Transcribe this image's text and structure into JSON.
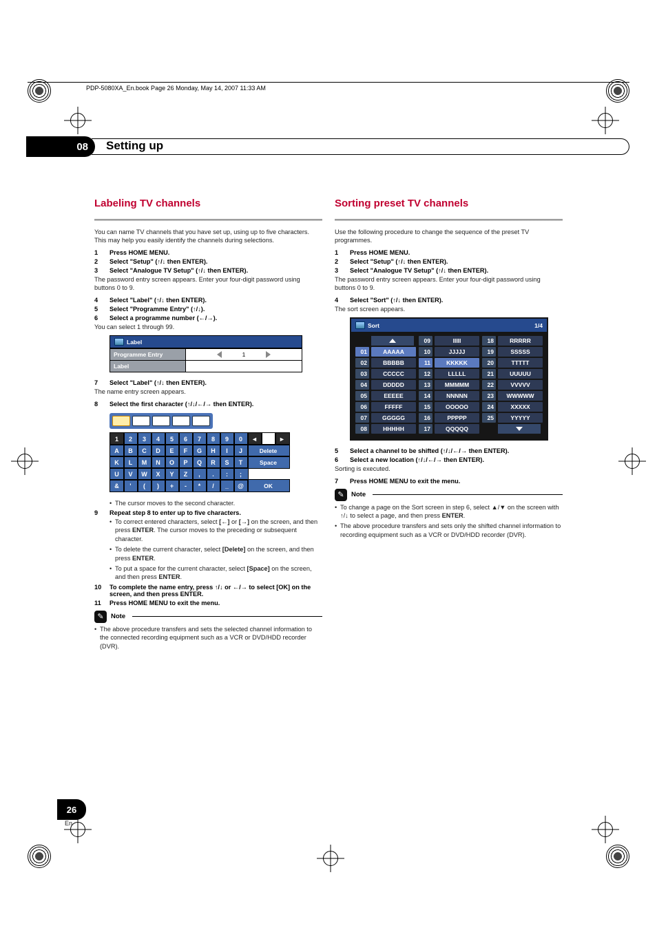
{
  "meta": {
    "header_text": "PDP-5080XA_En.book  Page 26  Monday, May 14, 2007  11:33 AM",
    "page_number": "26",
    "page_lang": "En"
  },
  "chapter": {
    "num": "08",
    "title": "Setting up"
  },
  "arrows": {
    "ud": "↑/↓",
    "lr": "←/→",
    "udlr": "↑/↓/←/→"
  },
  "left": {
    "heading": "Labeling TV channels",
    "intro": "You can name TV channels that you have set up, using up to five characters. This may help you easily identify the channels during selections.",
    "steps": {
      "s1": "Press HOME MENU.",
      "s2a": "Select \"Setup\" (",
      "s2b": " then ENTER).",
      "s3a": "Select \"Analogue TV Setup\" (",
      "s3b": " then ENTER).",
      "s3_sub": "The password entry screen appears. Enter your four-digit password using buttons 0 to 9.",
      "s4a": "Select \"Label\" (",
      "s4b": " then ENTER).",
      "s5a": "Select \"Programme Entry\" (",
      "s5b": ").",
      "s6a": "Select a programme number (",
      "s6b": ").",
      "s6_sub": "You can select 1 through 99.",
      "s7a": "Select \"Label\" (",
      "s7b": " then ENTER).",
      "s7_sub": "The name entry screen appears.",
      "s8a": "Select the first character (",
      "s8b": " then ENTER).",
      "s8_cursor": "The cursor moves to the second character.",
      "s9": "Repeat step 8 to enter up to five characters.",
      "s9_b1a": "To correct entered characters, select ",
      "s9_b1_left": "[←]",
      "s9_b1_or": " or ",
      "s9_b1_right": "[→]",
      "s9_b1b": " on the screen, and then press ",
      "s9_b1_enter": "ENTER",
      "s9_b1c": ". The cursor moves to the preceding or subsequent character.",
      "s9_b2a": "To delete the current character, select ",
      "s9_b2_del": "[Delete]",
      "s9_b2b": " on the screen, and then press ",
      "s9_b2_enter": "ENTER",
      "s9_b2c": ".",
      "s9_b3a": "To put a space for the current character, select ",
      "s9_b3_sp": "[Space]",
      "s9_b3b": " on the screen, and then press ",
      "s9_b3_enter": "ENTER",
      "s9_b3c": ".",
      "s10a": "To complete the name entry, press ",
      "s10b": " or ",
      "s10c": " to select [OK] on the screen, and then press ENTER.",
      "s11": "Press HOME MENU to exit the menu."
    },
    "label_panel": {
      "title": "Label",
      "row1_label": "Programme Entry",
      "row1_value": "1",
      "row2_label": "Label"
    },
    "kbd": {
      "r1": [
        "1",
        "2",
        "3",
        "4",
        "5",
        "6",
        "7",
        "8",
        "9",
        "0"
      ],
      "r1_extra": {
        "delete": "Delete"
      },
      "r2": [
        "A",
        "B",
        "C",
        "D",
        "E",
        "F",
        "G",
        "H",
        "I",
        "J"
      ],
      "r3": [
        "K",
        "L",
        "M",
        "N",
        "O",
        "P",
        "Q",
        "R",
        "S",
        "T"
      ],
      "r3_extra": {
        "space": "Space"
      },
      "r4": [
        "U",
        "V",
        "W",
        "X",
        "Y",
        "Z",
        ",",
        ".",
        ":",
        ";"
      ],
      "r5": [
        "&",
        "'",
        "(",
        ")",
        "+",
        "-",
        "*",
        "/",
        "_",
        "@"
      ],
      "r5_extra": {
        "ok": "OK"
      }
    },
    "note_label": "Note",
    "note_text": "The above procedure transfers and sets the selected channel information to the connected recording equipment such as a VCR or DVD/HDD recorder (DVR)."
  },
  "right": {
    "heading": "Sorting preset TV channels",
    "intro": "Use the following procedure to change the sequence of the preset TV programmes.",
    "steps": {
      "s1": "Press HOME MENU.",
      "s2a": "Select \"Setup\" (",
      "s2b": " then ENTER).",
      "s3a": "Select \"Analogue TV Setup\" (",
      "s3b": " then ENTER).",
      "s3_sub": "The password entry screen appears. Enter your four-digit password using buttons 0 to 9.",
      "s4a": "Select \"Sort\" (",
      "s4b": " then ENTER).",
      "s4_sub": "The sort screen appears.",
      "s5a": "Select a channel to be shifted (",
      "s5b": " then ENTER).",
      "s6a": "Select a new location (",
      "s6b": " then ENTER).",
      "s6_sub": "Sorting is executed.",
      "s7": "Press HOME MENU to exit the menu."
    },
    "sort_panel": {
      "title": "Sort",
      "page": "1/4",
      "cols": [
        [
          [
            "01",
            "AAAAA"
          ],
          [
            "02",
            "BBBBB"
          ],
          [
            "03",
            "CCCCC"
          ],
          [
            "04",
            "DDDDD"
          ],
          [
            "05",
            "EEEEE"
          ],
          [
            "06",
            "FFFFF"
          ],
          [
            "07",
            "GGGGG"
          ],
          [
            "08",
            "HHHHH"
          ]
        ],
        [
          [
            "09",
            "IIIII"
          ],
          [
            "10",
            "JJJJJ"
          ],
          [
            "11",
            "KKKKK"
          ],
          [
            "12",
            "LLLLL"
          ],
          [
            "13",
            "MMMMM"
          ],
          [
            "14",
            "NNNNN"
          ],
          [
            "15",
            "OOOOO"
          ],
          [
            "16",
            "PPPPP"
          ],
          [
            "17",
            "QQQQQ"
          ]
        ],
        [
          [
            "18",
            "RRRRR"
          ],
          [
            "19",
            "SSSSS"
          ],
          [
            "20",
            "TTTTT"
          ],
          [
            "21",
            "UUUUU"
          ],
          [
            "22",
            "VVVVV"
          ],
          [
            "23",
            "WWWWW"
          ],
          [
            "24",
            "XXXXX"
          ],
          [
            "25",
            "YYYYY"
          ]
        ]
      ]
    },
    "note_label": "Note",
    "note_b1a": "To change a page on the Sort screen in step 6, select ▲/▼ on the screen with ",
    "note_b1b": " to select a page, and then press ",
    "note_b1_enter": "ENTER",
    "note_b1c": ".",
    "note_b2": "The above procedure transfers and sets only the shifted channel information to recording equipment such as a VCR or DVD/HDD recorder (DVR)."
  }
}
